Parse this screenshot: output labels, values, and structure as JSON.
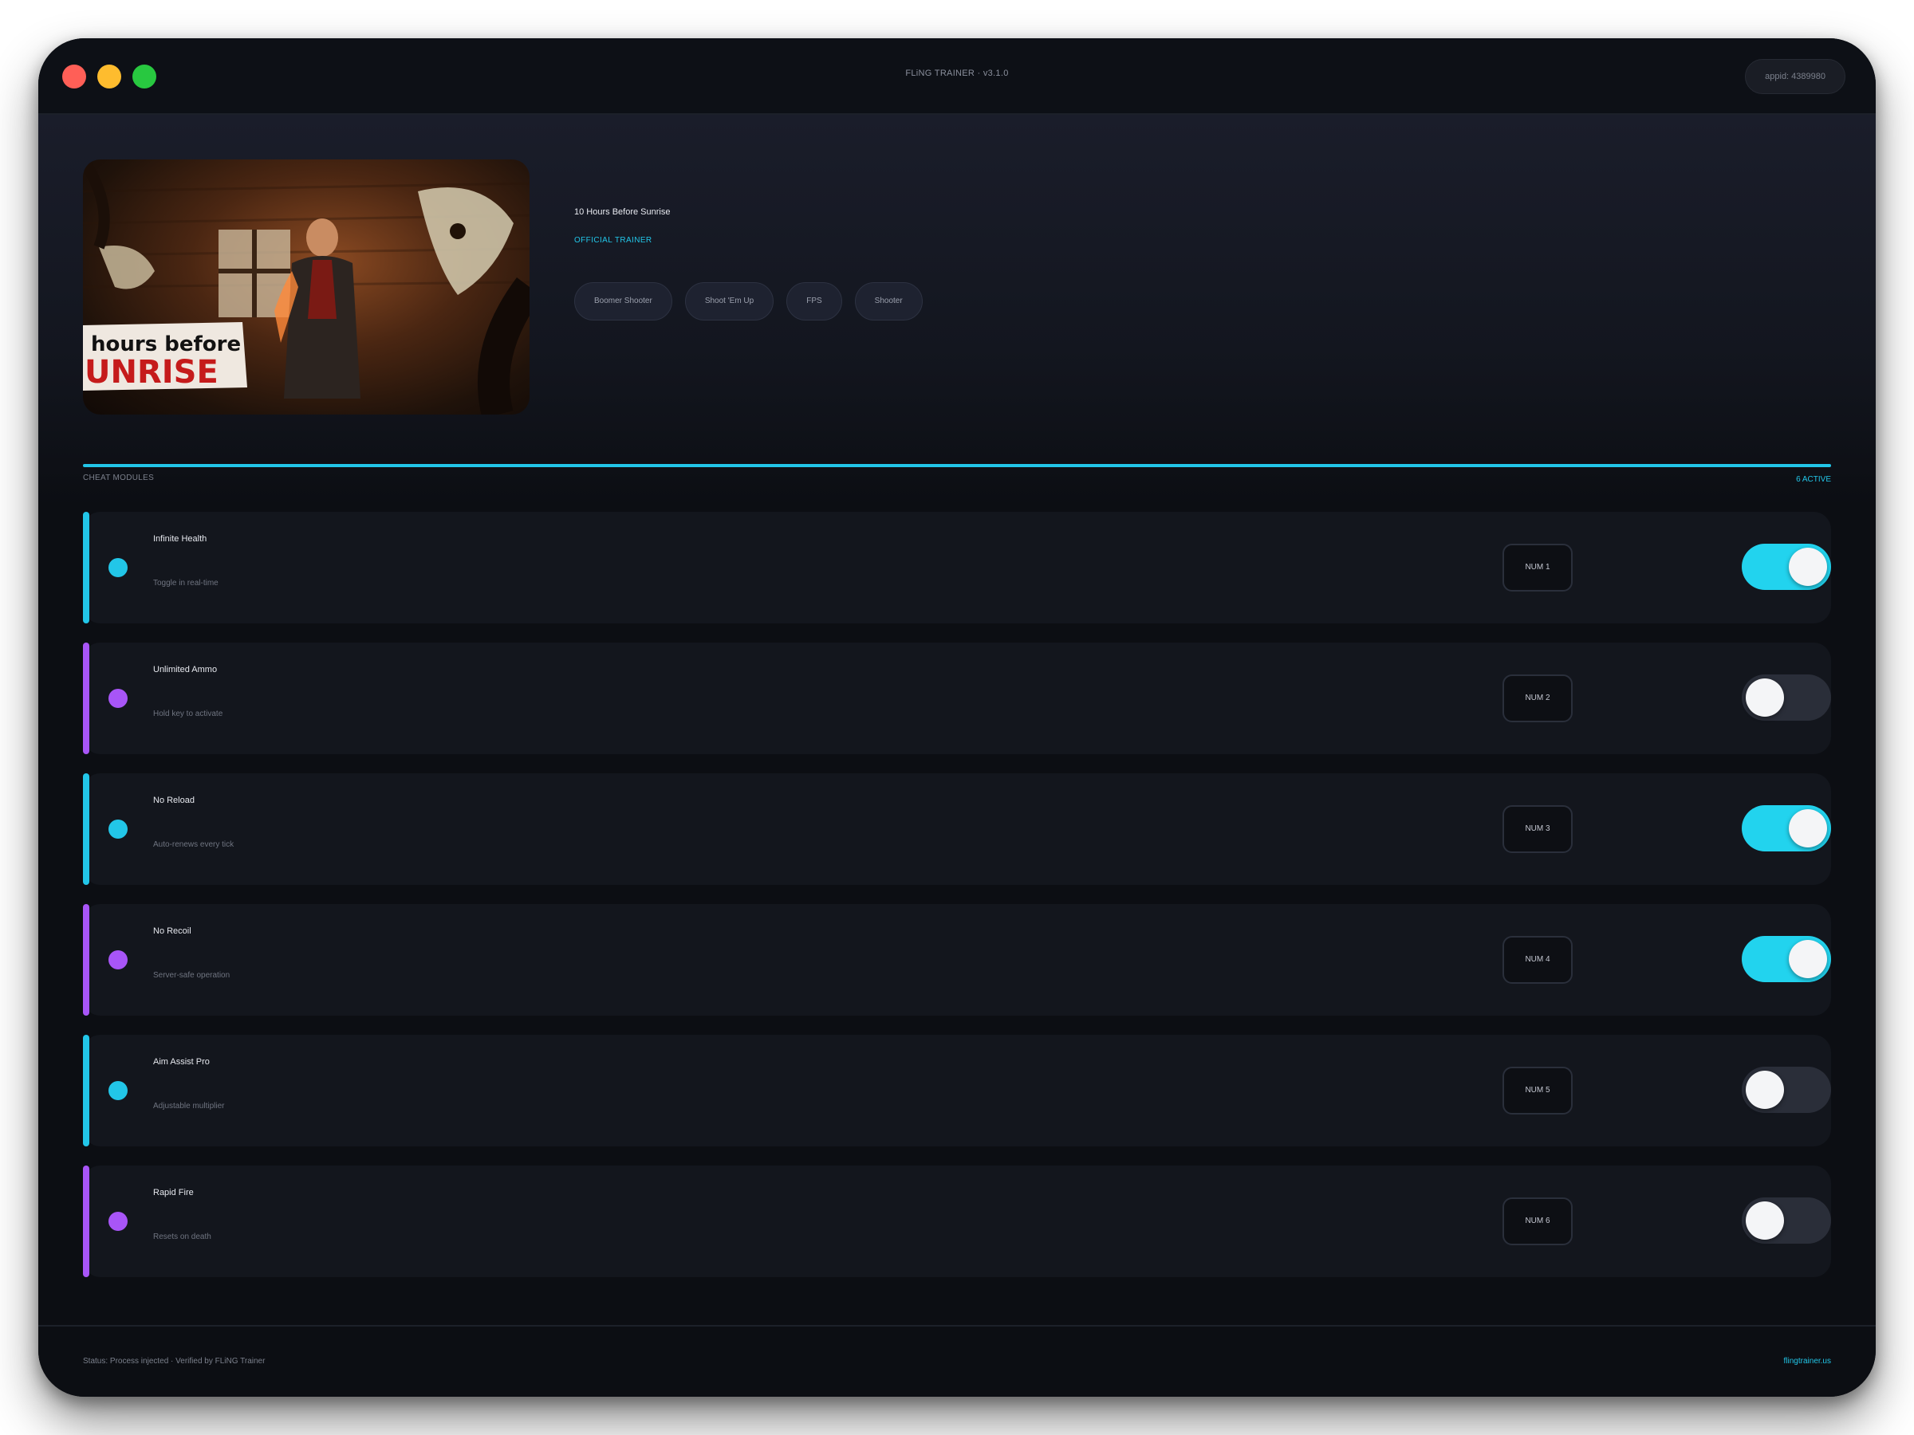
{
  "window": {
    "title": "FLiNG TRAINER · v3.1.0",
    "appid": "appid: 4389980"
  },
  "game": {
    "title": "10 Hours Before Sunrise",
    "badge": "OFFICIAL TRAINER",
    "cover_text_line1": "hours before",
    "cover_text_line2": "UNRISE",
    "tags": [
      "Boomer Shooter",
      "Shoot 'Em Up",
      "FPS",
      "Shooter"
    ]
  },
  "modules": {
    "section_label": "CHEAT MODULES",
    "active_count": "6 ACTIVE",
    "items": [
      {
        "name": "Infinite Health",
        "desc": "Toggle in real-time",
        "key": "NUM 1",
        "enabled": true,
        "accent": "#22c6e8"
      },
      {
        "name": "Unlimited Ammo",
        "desc": "Hold key to activate",
        "key": "NUM 2",
        "enabled": false,
        "accent": "#a855f7"
      },
      {
        "name": "No Reload",
        "desc": "Auto-renews every tick",
        "key": "NUM 3",
        "enabled": true,
        "accent": "#22c6e8"
      },
      {
        "name": "No Recoil",
        "desc": "Server-safe operation",
        "key": "NUM 4",
        "enabled": true,
        "accent": "#a855f7"
      },
      {
        "name": "Aim Assist Pro",
        "desc": "Adjustable multiplier",
        "key": "NUM 5",
        "enabled": false,
        "accent": "#22c6e8"
      },
      {
        "name": "Rapid Fire",
        "desc": "Resets on death",
        "key": "NUM 6",
        "enabled": false,
        "accent": "#a855f7"
      }
    ]
  },
  "footer": {
    "status": "Status: Process injected · Verified by FLiNG Trainer",
    "site": "flingtrainer.us"
  }
}
